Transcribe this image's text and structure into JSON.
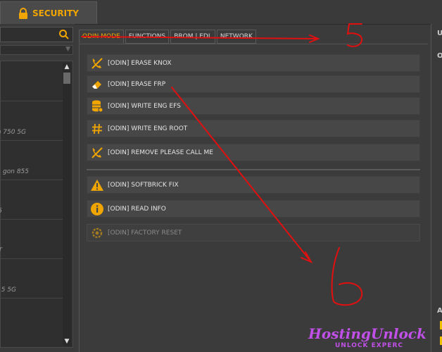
{
  "header": {
    "security_tab": "SECURITY"
  },
  "left": {
    "devices": [
      {
        "label": ""
      },
      {
        "label": "on 750 5G"
      },
      {
        "label": "gon 855"
      },
      {
        "label": "5"
      },
      {
        "label": "T"
      },
      {
        "label": "5 5G"
      },
      {
        "label": ""
      }
    ]
  },
  "tabs": [
    {
      "label": "ODIN MODE",
      "active": true
    },
    {
      "label": "FUNCTIONS"
    },
    {
      "label": "BROM | EDL"
    },
    {
      "label": "NETWORK"
    }
  ],
  "buttons": [
    {
      "label": "[ODIN] ERASE KNOX",
      "icon": "phone-off-icon"
    },
    {
      "label": "[ODIN] ERASE FRP",
      "icon": "eraser-icon"
    },
    {
      "label": "[ODIN] WRITE ENG EFS",
      "icon": "database-icon"
    },
    {
      "label": "[ODIN] WRITE ENG ROOT",
      "icon": "hash-icon"
    },
    {
      "label": "[ODIN] REMOVE PLEASE CALL ME",
      "icon": "phone-off-icon"
    },
    {
      "label": "[ODIN] SOFTBRICK FIX",
      "icon": "warning-icon"
    },
    {
      "label": "[ODIN] READ INFO",
      "icon": "info-icon"
    },
    {
      "label": "[ODIN] FACTORY RESET",
      "icon": "gear-reset-icon",
      "disabled": true
    }
  ],
  "right": {
    "top_letter": "U",
    "mid_letter": "O",
    "low_letter": "A"
  },
  "annotations": {
    "number_5": "5",
    "number_6": "6",
    "arrow_color": "#e01010"
  },
  "watermark": {
    "main": "HostingUnlock",
    "sub": "UNLOCK EXPERC"
  },
  "colors": {
    "accent": "#f0a500",
    "watermark": "#c050e8"
  }
}
